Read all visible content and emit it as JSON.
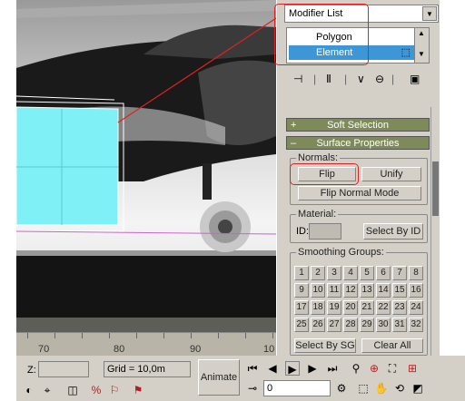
{
  "modifier": {
    "list_label": "Modifier List",
    "stack_items": [
      "Polygon",
      "Element"
    ],
    "selected": "Element"
  },
  "rollouts": {
    "soft_selection": "Soft Selection",
    "surface_properties": "Surface Properties"
  },
  "normals": {
    "group_label": "Normals:",
    "flip": "Flip",
    "unify": "Unify",
    "flip_mode": "Flip Normal Mode"
  },
  "material": {
    "group_label": "Material:",
    "id_label": "ID:",
    "select_by_id": "Select By ID"
  },
  "smoothing": {
    "group_label": "Smoothing Groups:",
    "buttons": [
      "1",
      "2",
      "3",
      "4",
      "5",
      "6",
      "7",
      "8",
      "9",
      "10",
      "11",
      "12",
      "13",
      "14",
      "15",
      "16",
      "17",
      "18",
      "19",
      "20",
      "21",
      "22",
      "23",
      "24",
      "25",
      "26",
      "27",
      "28",
      "29",
      "30",
      "31",
      "32"
    ],
    "select_by_sg": "Select By SG",
    "clear_all": "Clear All"
  },
  "timeline": {
    "labels": [
      "70",
      "80",
      "90",
      "10"
    ]
  },
  "status": {
    "z_label": "Z:",
    "grid": "Grid = 10,0m",
    "animate": "Animate",
    "frame_value": "0"
  }
}
